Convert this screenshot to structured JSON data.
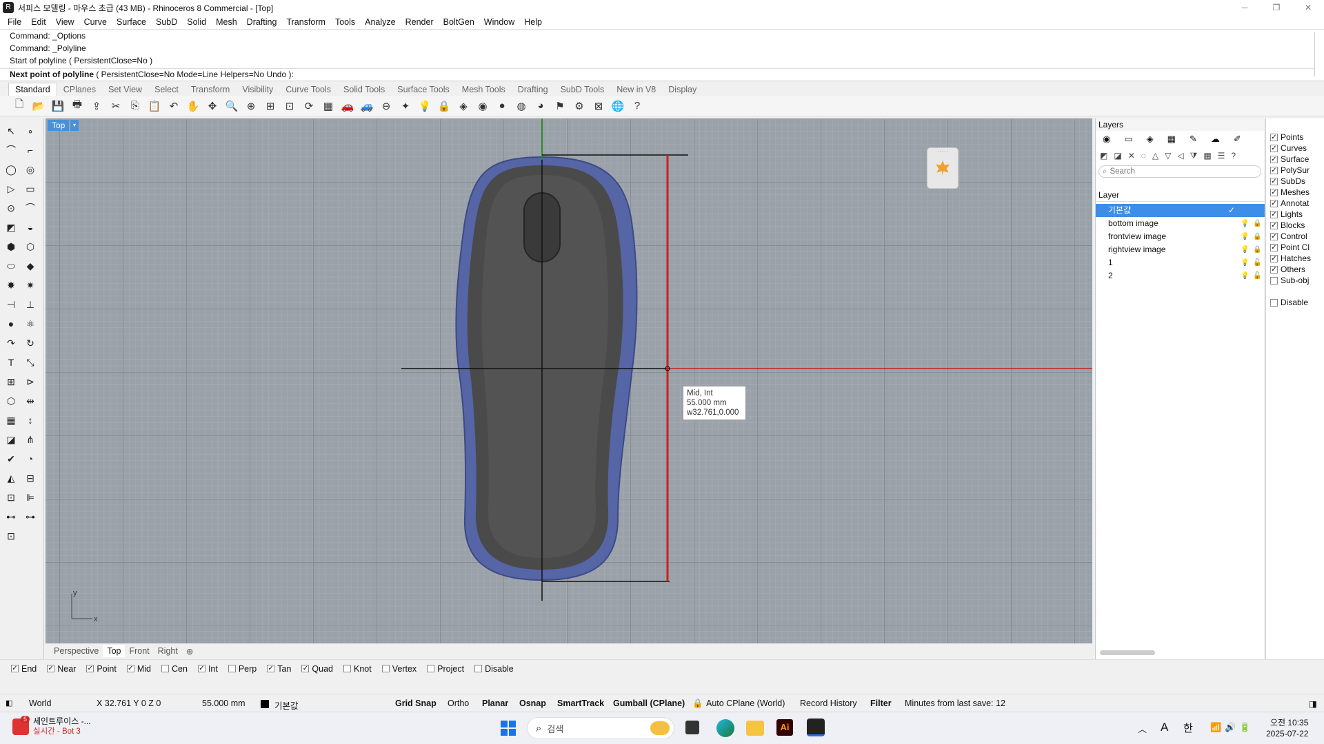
{
  "app": {
    "title": "서피스 모델링 - 마우스 초급 (43 MB) - Rhinoceros 8 Commercial - [Top]",
    "logo_icon": "rhino-logo-icon",
    "window_buttons": [
      "─",
      "❐",
      "✕"
    ]
  },
  "menu": [
    "File",
    "Edit",
    "View",
    "Curve",
    "Surface",
    "SubD",
    "Solid",
    "Mesh",
    "Drafting",
    "Transform",
    "Tools",
    "Analyze",
    "Render",
    "BoltGen",
    "Window",
    "Help"
  ],
  "command": {
    "history": [
      "Command: _Options",
      "Command: _Polyline",
      "Start of polyline ( PersistentClose=No )"
    ],
    "prompt_label": "Next point of polyline",
    "prompt_options": "( PersistentClose=No  Mode=Line  Helpers=No  Undo ):"
  },
  "toolbar_tabs": [
    "Standard",
    "CPlanes",
    "Set View",
    "Select",
    "Transform",
    "Visibility",
    "Curve Tools",
    "Solid Tools",
    "Surface Tools",
    "Mesh Tools",
    "Drafting",
    "SubD Tools",
    "New in V8",
    "Display"
  ],
  "toolbar_icons": [
    "new-file-icon",
    "open-file-icon",
    "save-icon",
    "print-icon",
    "import-icon",
    "cut-icon",
    "copy-icon",
    "paste-icon",
    "undo-icon",
    "pan-icon",
    "rotate-view-icon",
    "zoom-icon",
    "zoom-window-icon",
    "zoom-extents-icon",
    "zoom-selected-icon",
    "rotate-icon",
    "four-viewports-icon",
    "car-icon",
    "car-outline-icon",
    "cplane-icon",
    "lasso-icon",
    "light-bulb-icon",
    "lock-icon",
    "materials-icon",
    "color-wheel-icon",
    "sphere-icon",
    "render-sphere-icon",
    "shaded-sphere-icon",
    "flag-icon",
    "gear-icon",
    "grid-snap-icon",
    "globe-icon",
    "help-icon"
  ],
  "toolbar_glyphs": [
    "🗋",
    "📂",
    "💾",
    "🖶",
    "⇪",
    "✂",
    "⎘",
    "📋",
    "↶",
    "✋",
    "✥",
    "🔍",
    "⊕",
    "⊞",
    "⊡",
    "⟳",
    "▦",
    "🚗",
    "🚙",
    "⊖",
    "✦",
    "💡",
    "🔒",
    "◈",
    "◉",
    "●",
    "◍",
    "◕",
    "⚑",
    "⚙",
    "⊠",
    "🌐",
    "?"
  ],
  "left_tools": [
    "↖",
    "∘",
    "⌒",
    "⌐",
    "◯",
    "◎",
    "▷",
    "▭",
    "⊙",
    "⌒",
    "◩",
    "◒",
    "⬢",
    "⬡",
    "⬭",
    "◆",
    "✸",
    "✷",
    "⊣",
    "⊥",
    "●",
    "⚛",
    "↷",
    "↻",
    "T",
    "⤡",
    "⊞",
    "⊳",
    "⬡",
    "⇹",
    "▦",
    "↕",
    "◪",
    "⋔",
    "✔",
    "◔",
    "◭",
    "⊟",
    "⊡",
    "⊫",
    "⊷",
    "⊶",
    "⊡"
  ],
  "viewport": {
    "name": "Top",
    "dropdown": "▾",
    "tooltip": [
      "Mid, Int",
      "55.000 mm",
      "w32.761,0.000"
    ],
    "axis_y": "y",
    "axis_x": "x",
    "floating_icon": "maple-leaf-icon"
  },
  "viewport_tabs": [
    "Perspective",
    "Top",
    "Front",
    "Right",
    "⊕"
  ],
  "layers": {
    "panel_title": "Layers",
    "search_placeholder": "Search",
    "column_header": "Layer",
    "rows": [
      {
        "name": "기본값",
        "current": true,
        "check": "✓"
      },
      {
        "name": "bottom image",
        "locked": true
      },
      {
        "name": "frontview image",
        "locked": true
      },
      {
        "name": "rightview image",
        "locked": true
      },
      {
        "name": "1",
        "locked": false
      },
      {
        "name": "2",
        "locked": false
      }
    ],
    "bulb_glyph": "💡",
    "lock_glyph": "🔒",
    "unlock_glyph": "🔓"
  },
  "selection_filters": {
    "items": [
      {
        "label": "Points",
        "checked": true
      },
      {
        "label": "Curves",
        "checked": true
      },
      {
        "label": "Surface",
        "checked": true
      },
      {
        "label": "PolySur",
        "checked": true
      },
      {
        "label": "SubDs",
        "checked": true
      },
      {
        "label": "Meshes",
        "checked": true
      },
      {
        "label": "Annotat",
        "checked": true
      },
      {
        "label": "Lights",
        "checked": true
      },
      {
        "label": "Blocks",
        "checked": true
      },
      {
        "label": "Control",
        "checked": true
      },
      {
        "label": "Point Cl",
        "checked": true
      },
      {
        "label": "Hatches",
        "checked": true
      },
      {
        "label": "Others",
        "checked": true
      },
      {
        "label": "Sub-obj",
        "checked": false
      }
    ],
    "disable_label": "Disable"
  },
  "osnap": [
    {
      "label": "End",
      "checked": true
    },
    {
      "label": "Near",
      "checked": true
    },
    {
      "label": "Point",
      "checked": true
    },
    {
      "label": "Mid",
      "checked": true
    },
    {
      "label": "Cen",
      "checked": false
    },
    {
      "label": "Int",
      "checked": true
    },
    {
      "label": "Perp",
      "checked": false
    },
    {
      "label": "Tan",
      "checked": true
    },
    {
      "label": "Quad",
      "checked": true
    },
    {
      "label": "Knot",
      "checked": false
    },
    {
      "label": "Vertex",
      "checked": false
    },
    {
      "label": "Project",
      "checked": false
    },
    {
      "label": "Disable",
      "checked": false
    }
  ],
  "status": {
    "cplane": "World",
    "coords": "X 32.761 Y 0 Z 0",
    "distance": "55.000 mm",
    "layer": "기본값",
    "grid_snap": "Grid Snap",
    "ortho": "Ortho",
    "planar": "Planar",
    "osnap": "Osnap",
    "smarttrack": "SmartTrack",
    "gumball": "Gumball (CPlane)",
    "auto_cplane": "Auto CPlane (World)",
    "record_history": "Record History",
    "filter": "Filter",
    "last_save": "Minutes from last save: 12"
  },
  "taskbar": {
    "app_name": "세인트루이스 -...",
    "app_sub": "실시간 - Bot 3",
    "badge": "5",
    "search_placeholder": "검색",
    "time": "오전 10:35",
    "date": "2025-07-22",
    "ime_a": "A",
    "ime_han": "한",
    "ai_label": "Ai",
    "colors": {
      "accent": "#3d8ee8",
      "mouse_blue": "#5566a8",
      "mouse_body": "#505050",
      "red": "#cc2020"
    }
  }
}
